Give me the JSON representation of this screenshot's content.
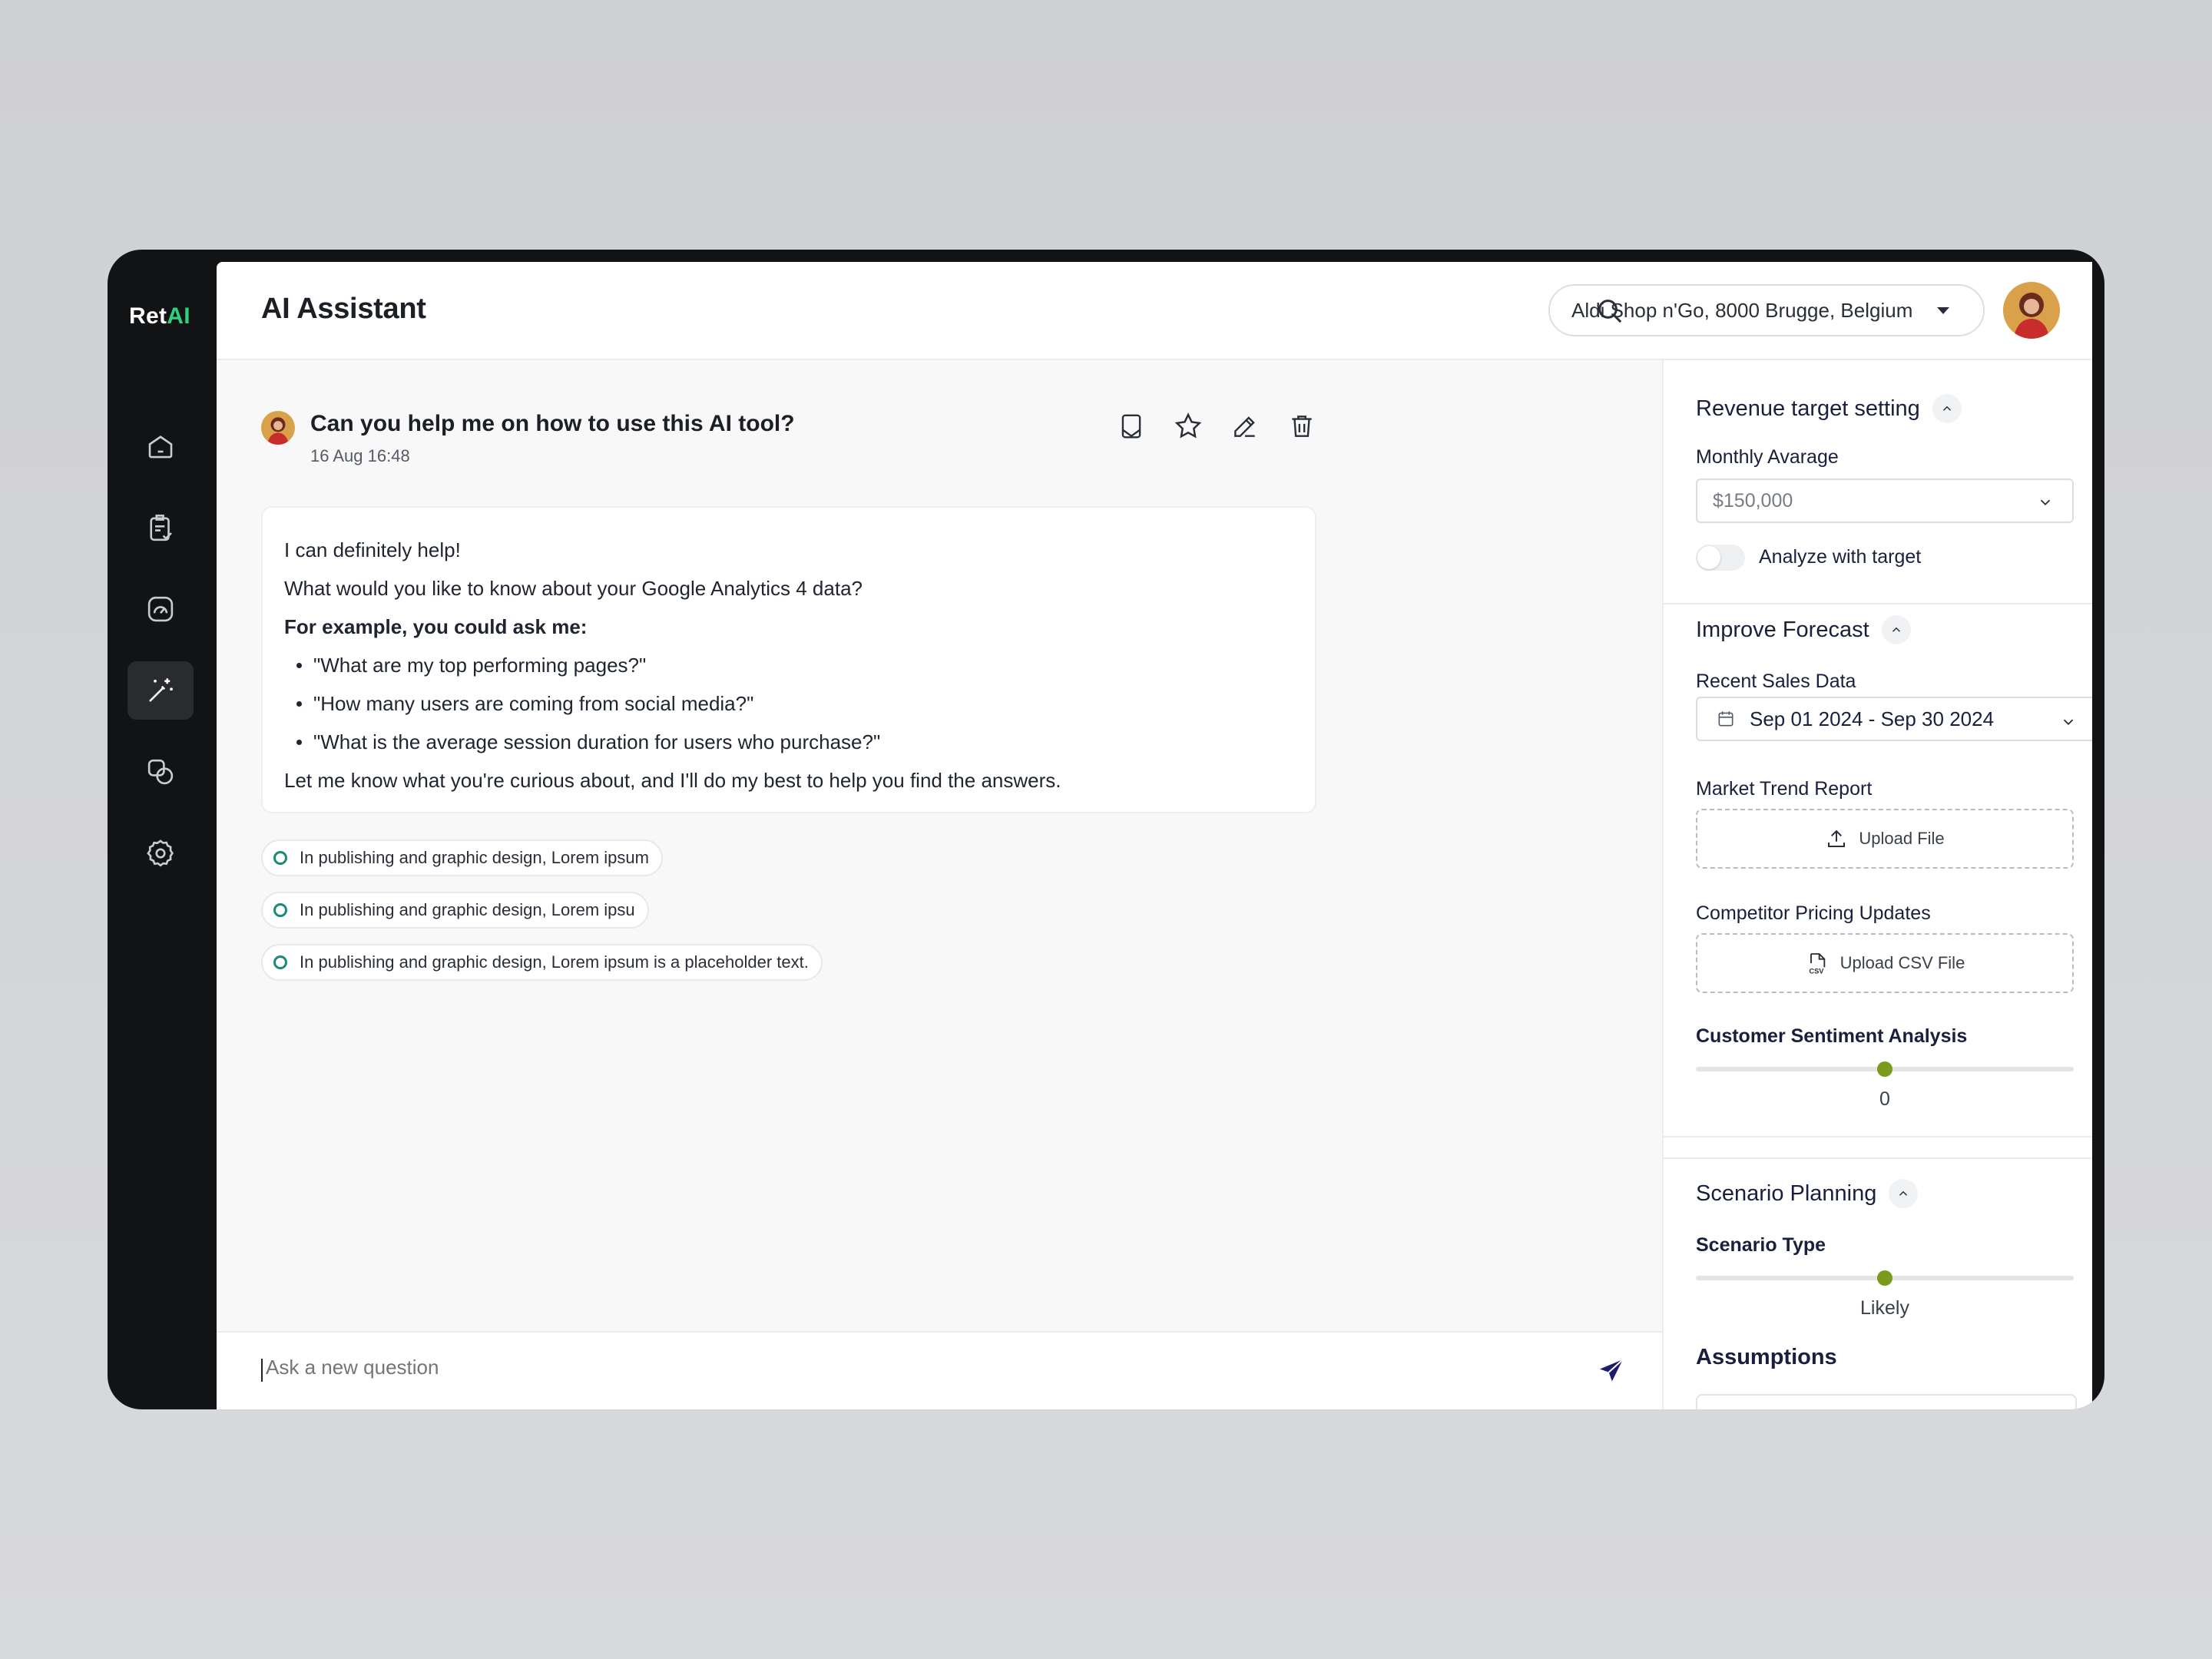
{
  "app": {
    "logo_main": "Ret",
    "logo_accent": "AI"
  },
  "sidebar": {
    "items": [
      {
        "name": "home-icon"
      },
      {
        "name": "clipboard-check-icon"
      },
      {
        "name": "gauge-icon"
      },
      {
        "name": "magic-wand-icon",
        "active": true
      },
      {
        "name": "shapes-icon"
      },
      {
        "name": "settings-gear-icon"
      }
    ]
  },
  "header": {
    "title": "AI Assistant",
    "location": "Aldi Shop n'Go, 8000 Brugge, Belgium"
  },
  "conversation": {
    "question": "Can you help me on how to use this AI tool?",
    "timestamp": "16 Aug 16:48",
    "answer": {
      "line1": "I can definitely help!",
      "line2": "What would you like to know about your Google Analytics 4 data?",
      "line3": "For example, you could ask me:",
      "bullets": [
        "\"What are my top performing pages?\"",
        "\"How many users are coming from social media?\"",
        "\"What is the average session duration for users who purchase?\""
      ],
      "closing": "Let me know what you're curious about, and I'll do my best to help you find the answers."
    },
    "suggestions": [
      "In publishing and graphic design, Lorem ipsum",
      "In publishing and graphic design, Lorem ipsu",
      "In publishing and graphic design, Lorem ipsum is a placeholder text."
    ]
  },
  "composer": {
    "placeholder": "Ask a new question"
  },
  "panel": {
    "revenue": {
      "title": "Revenue target setting",
      "monthly_label": "Monthly Avarage",
      "monthly_value": "$150,000",
      "toggle_label": "Analyze with target",
      "toggle_on": false
    },
    "forecast": {
      "title": "Improve Forecast",
      "recent_label": "Recent Sales Data",
      "recent_value": "Sep 01 2024 - Sep 30 2024",
      "market_label": "Market Trend Report",
      "market_button": "Upload File",
      "competitor_label": "Competitor Pricing Updates",
      "competitor_button": "Upload CSV File",
      "sentiment_label": "Customer Sentiment Analysis",
      "sentiment_value": "0",
      "sentiment_fraction": 0.5
    },
    "scenario": {
      "title": "Scenario Planning",
      "type_label": "Scenario Type",
      "type_value": "Likely",
      "type_fraction": 0.5,
      "assumptions_title": "Assumptions"
    }
  },
  "colors": {
    "accent_green": "#2fd07f",
    "slider_thumb": "#7a9a1c",
    "suggestion_ring": "#1b8a7a",
    "send_icon": "#1f1b6b"
  }
}
